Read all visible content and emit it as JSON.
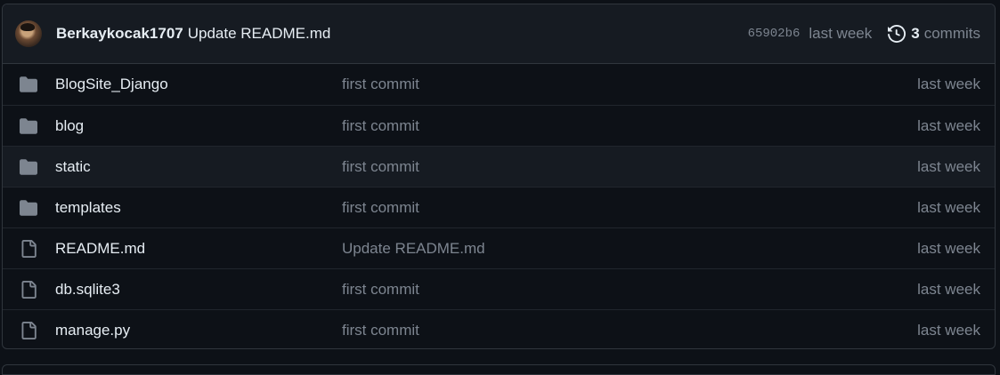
{
  "commit": {
    "author": "Berkaykocak1707",
    "message": "Update README.md",
    "sha": "65902b6",
    "time": "last week",
    "commits_count": "3",
    "commits_label": "commits"
  },
  "files": [
    {
      "name": "BlogSite_Django",
      "type": "folder",
      "message": "first commit",
      "time": "last week"
    },
    {
      "name": "blog",
      "type": "folder",
      "message": "first commit",
      "time": "last week"
    },
    {
      "name": "static",
      "type": "folder",
      "message": "first commit",
      "time": "last week"
    },
    {
      "name": "templates",
      "type": "folder",
      "message": "first commit",
      "time": "last week"
    },
    {
      "name": "README.md",
      "type": "file",
      "message": "Update README.md",
      "time": "last week"
    },
    {
      "name": "db.sqlite3",
      "type": "file",
      "message": "first commit",
      "time": "last week"
    },
    {
      "name": "manage.py",
      "type": "file",
      "message": "first commit",
      "time": "last week"
    }
  ],
  "icons": {
    "folder": "folder-icon",
    "file": "file-icon",
    "history": "history-icon"
  },
  "colors": {
    "background": "#0d1117",
    "header": "#161b22",
    "border": "#30363d",
    "text": "#e6edf3",
    "muted": "#7d8590"
  }
}
